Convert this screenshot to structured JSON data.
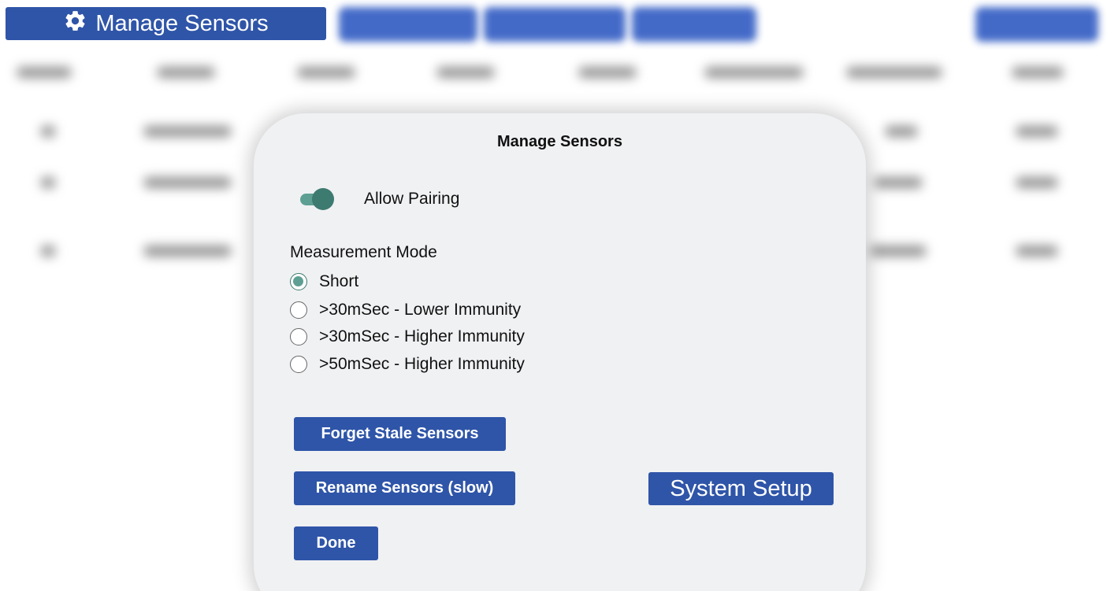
{
  "topbar": {
    "manage_button_label": "Manage Sensors",
    "manage_button_icon": "gear-icon"
  },
  "modal": {
    "title": "Manage Sensors",
    "allow_pairing": {
      "label": "Allow Pairing",
      "enabled": true
    },
    "measurement_mode": {
      "label": "Measurement Mode",
      "selected": "Short",
      "options": [
        "Short",
        ">30mSec - Lower Immunity",
        ">30mSec - Higher Immunity",
        ">50mSec - Higher Immunity"
      ]
    },
    "buttons": {
      "forget": "Forget Stale Sensors",
      "rename": "Rename Sensors (slow)",
      "done": "Done",
      "system_setup": "System Setup"
    }
  },
  "colors": {
    "primary_blue": "#2f55a8",
    "toggle_teal": "#5e9f93",
    "modal_bg": "#f0f1f3"
  }
}
